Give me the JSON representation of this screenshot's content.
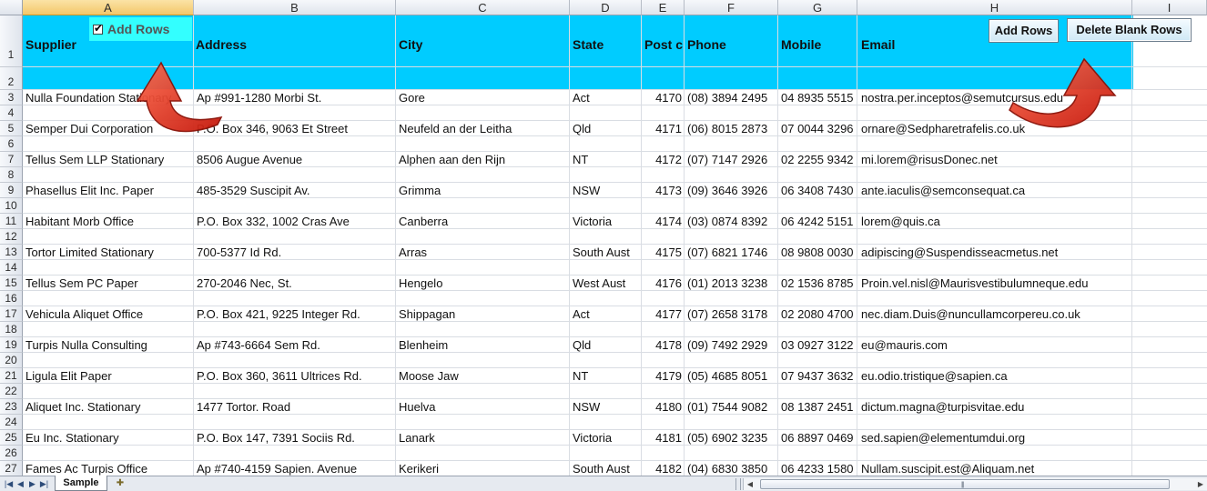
{
  "columns": [
    "A",
    "B",
    "C",
    "D",
    "E",
    "F",
    "G",
    "H",
    "I"
  ],
  "header_row": {
    "supplier": "Supplier",
    "address": "Address",
    "city": "City",
    "state": "State",
    "postcode": "Post c",
    "phone": "Phone",
    "mobile": "Mobile",
    "email": "Email"
  },
  "controls": {
    "checkbox_label": "Add Rows",
    "checkbox_checked": true,
    "add_rows_button": "Add Rows",
    "delete_blank_rows_button": "Delete Blank Rows"
  },
  "row_numbers": [
    "1",
    "2",
    "3",
    "4",
    "5",
    "6",
    "7",
    "8",
    "9",
    "10",
    "11",
    "12",
    "13",
    "14",
    "15",
    "16",
    "17",
    "18",
    "19",
    "20",
    "21",
    "22",
    "23",
    "24",
    "25",
    "26",
    "27"
  ],
  "rows": [
    {
      "supplier": "Nulla Foundation Stationary",
      "address": "Ap #991-1280 Morbi St.",
      "city": "Gore",
      "state": "Act",
      "postcode": "4170",
      "phone": "(08) 3894 2495",
      "mobile": "04 8935 5515",
      "email": "nostra.per.inceptos@semutcursus.edu"
    },
    {
      "supplier": "Semper Dui Corporation",
      "address": "P.O. Box 346, 9063 Et Street",
      "city": "Neufeld an der Leitha",
      "state": "Qld",
      "postcode": "4171",
      "phone": "(06) 8015 2873",
      "mobile": "07 0044 3296",
      "email": "ornare@Sedpharetrafelis.co.uk"
    },
    {
      "supplier": "Tellus Sem LLP Stationary",
      "address": "8506 Augue Avenue",
      "city": "Alphen aan den Rijn",
      "state": "NT",
      "postcode": "4172",
      "phone": "(07) 7147 2926",
      "mobile": "02 2255 9342",
      "email": "mi.lorem@risusDonec.net"
    },
    {
      "supplier": "Phasellus Elit Inc. Paper",
      "address": "485-3529 Suscipit Av.",
      "city": "Grimma",
      "state": "NSW",
      "postcode": "4173",
      "phone": "(09) 3646 3926",
      "mobile": "06 3408 7430",
      "email": "ante.iaculis@semconsequat.ca"
    },
    {
      "supplier": "Habitant Morb Office",
      "address": "P.O. Box 332, 1002 Cras Ave",
      "city": "Canberra",
      "state": "Victoria",
      "postcode": "4174",
      "phone": "(03) 0874 8392",
      "mobile": "06 4242 5151",
      "email": "lorem@quis.ca"
    },
    {
      "supplier": "Tortor Limited Stationary",
      "address": "700-5377 Id Rd.",
      "city": "Arras",
      "state": "South Aust",
      "postcode": "4175",
      "phone": "(07) 6821 1746",
      "mobile": "08 9808 0030",
      "email": "adipiscing@Suspendisseacmetus.net"
    },
    {
      "supplier": "Tellus Sem PC Paper",
      "address": "270-2046 Nec, St.",
      "city": "Hengelo",
      "state": "West Aust",
      "postcode": "4176",
      "phone": "(01) 2013 3238",
      "mobile": "02 1536 8785",
      "email": "Proin.vel.nisl@Maurisvestibulumneque.edu"
    },
    {
      "supplier": "Vehicula Aliquet Office",
      "address": "P.O. Box 421, 9225 Integer Rd.",
      "city": "Shippagan",
      "state": "Act",
      "postcode": "4177",
      "phone": "(07) 2658 3178",
      "mobile": "02 2080 4700",
      "email": "nec.diam.Duis@nuncullamcorpereu.co.uk"
    },
    {
      "supplier": "Turpis Nulla Consulting",
      "address": "Ap #743-6664 Sem Rd.",
      "city": "Blenheim",
      "state": "Qld",
      "postcode": "4178",
      "phone": "(09) 7492 2929",
      "mobile": "03 0927 3122",
      "email": "eu@mauris.com"
    },
    {
      "supplier": "Ligula Elit Paper",
      "address": "P.O. Box 360, 3611 Ultrices Rd.",
      "city": "Moose Jaw",
      "state": "NT",
      "postcode": "4179",
      "phone": "(05) 4685 8051",
      "mobile": "07 9437 3632",
      "email": "eu.odio.tristique@sapien.ca"
    },
    {
      "supplier": "Aliquet Inc. Stationary",
      "address": "1477 Tortor. Road",
      "city": "Huelva",
      "state": "NSW",
      "postcode": "4180",
      "phone": "(01) 7544 9082",
      "mobile": "08 1387 2451",
      "email": "dictum.magna@turpisvitae.edu"
    },
    {
      "supplier": "Eu Inc. Stationary",
      "address": "P.O. Box 147, 7391 Sociis Rd.",
      "city": "Lanark",
      "state": "Victoria",
      "postcode": "4181",
      "phone": "(05) 6902 3235",
      "mobile": "06 8897 0469",
      "email": "sed.sapien@elementumdui.org"
    },
    {
      "supplier": "Fames Ac Turpis  Office",
      "address": "Ap #740-4159 Sapien. Avenue",
      "city": "Kerikeri",
      "state": "South Aust",
      "postcode": "4182",
      "phone": "(04) 6830 3850",
      "mobile": "06 4233 1580",
      "email": "Nullam.suscipit.est@Aliquam.net"
    }
  ],
  "sheet_tab": "Sample",
  "colors": {
    "header_band": "#00ccff",
    "checkbox_band": "#33ffff",
    "arrow": "#e8321c"
  }
}
